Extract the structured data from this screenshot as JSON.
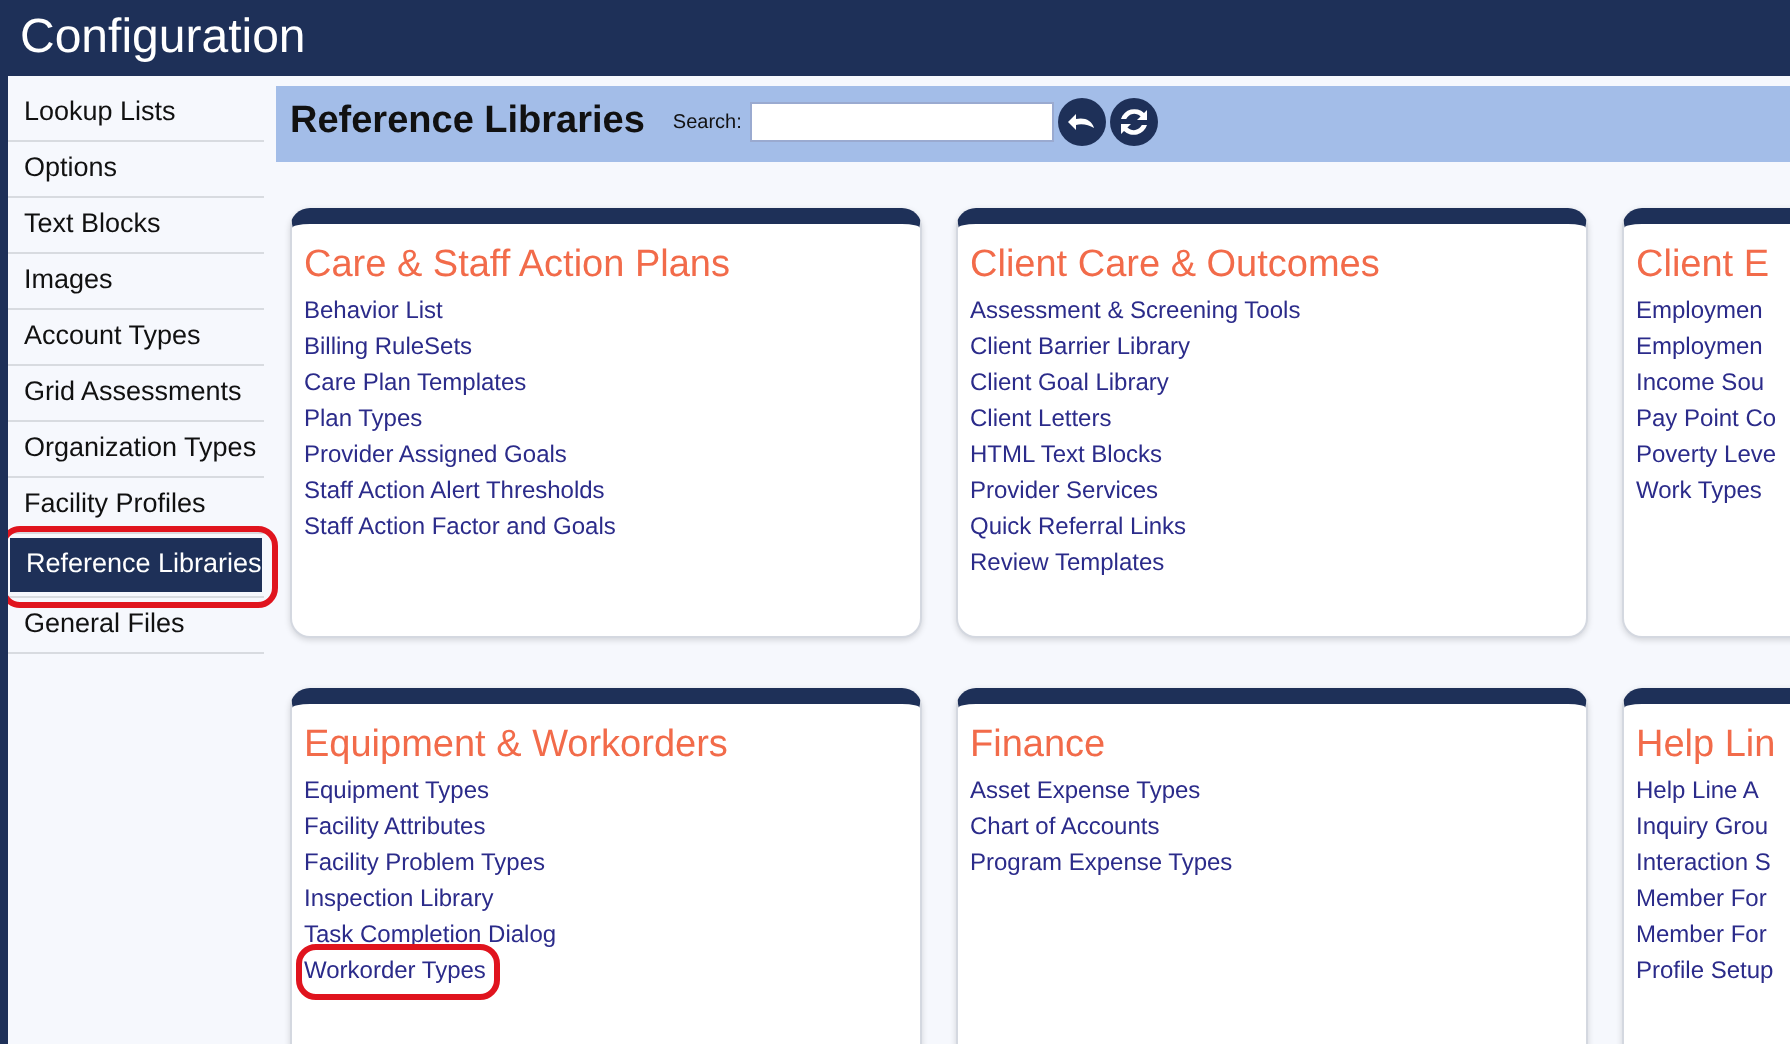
{
  "window": {
    "title": "Configuration"
  },
  "sidebar": {
    "items": [
      {
        "label": "Lookup Lists",
        "selected": false,
        "circled": false
      },
      {
        "label": "Options",
        "selected": false,
        "circled": false
      },
      {
        "label": "Text Blocks",
        "selected": false,
        "circled": false
      },
      {
        "label": "Images",
        "selected": false,
        "circled": false
      },
      {
        "label": "Account Types",
        "selected": false,
        "circled": false
      },
      {
        "label": "Grid Assessments",
        "selected": false,
        "circled": false
      },
      {
        "label": "Organization Types",
        "selected": false,
        "circled": false
      },
      {
        "label": "Facility Profiles",
        "selected": false,
        "circled": false
      },
      {
        "label": "Reference Libraries",
        "selected": true,
        "circled": true
      },
      {
        "label": "General Files",
        "selected": false,
        "circled": false
      }
    ]
  },
  "header": {
    "title": "Reference Libraries",
    "search": {
      "label": "Search:"
    }
  },
  "cards": [
    {
      "title": "Care & Staff Action Plans",
      "links": [
        {
          "label": "Behavior List",
          "circled": false
        },
        {
          "label": "Billing RuleSets",
          "circled": false
        },
        {
          "label": "Care Plan Templates",
          "circled": false
        },
        {
          "label": "Plan Types",
          "circled": false
        },
        {
          "label": "Provider Assigned Goals",
          "circled": false
        },
        {
          "label": "Staff Action Alert Thresholds",
          "circled": false
        },
        {
          "label": "Staff Action Factor and Goals",
          "circled": false
        }
      ]
    },
    {
      "title": "Client Care & Outcomes",
      "links": [
        {
          "label": "Assessment & Screening Tools",
          "circled": false
        },
        {
          "label": "Client Barrier Library",
          "circled": false
        },
        {
          "label": "Client Goal Library",
          "circled": false
        },
        {
          "label": "Client Letters",
          "circled": false
        },
        {
          "label": "HTML Text Blocks",
          "circled": false
        },
        {
          "label": "Provider Services",
          "circled": false
        },
        {
          "label": "Quick Referral Links",
          "circled": false
        },
        {
          "label": "Review Templates",
          "circled": false
        }
      ]
    },
    {
      "title": "Client E",
      "links": [
        {
          "label": "Employmen",
          "circled": false
        },
        {
          "label": "Employmen",
          "circled": false
        },
        {
          "label": "Income Sou",
          "circled": false
        },
        {
          "label": "Pay Point Co",
          "circled": false
        },
        {
          "label": "Poverty Leve",
          "circled": false
        },
        {
          "label": "Work Types",
          "circled": false
        }
      ]
    },
    {
      "title": "Equipment & Workorders",
      "links": [
        {
          "label": "Equipment Types",
          "circled": false
        },
        {
          "label": "Facility Attributes",
          "circled": false
        },
        {
          "label": "Facility Problem Types",
          "circled": false
        },
        {
          "label": "Inspection Library",
          "circled": false
        },
        {
          "label": "Task Completion Dialog",
          "circled": false
        },
        {
          "label": "Workorder Types",
          "circled": true
        }
      ]
    },
    {
      "title": "Finance",
      "links": [
        {
          "label": "Asset Expense Types",
          "circled": false
        },
        {
          "label": "Chart of Accounts",
          "circled": false
        },
        {
          "label": "Program Expense Types",
          "circled": false
        }
      ]
    },
    {
      "title": "Help Lin",
      "links": [
        {
          "label": "Help Line A",
          "circled": false
        },
        {
          "label": "Inquiry Grou",
          "circled": false
        },
        {
          "label": "Interaction S",
          "circled": false
        },
        {
          "label": "Member For",
          "circled": false
        },
        {
          "label": "Member For",
          "circled": false
        },
        {
          "label": "Profile Setup",
          "circled": false
        }
      ]
    }
  ]
}
